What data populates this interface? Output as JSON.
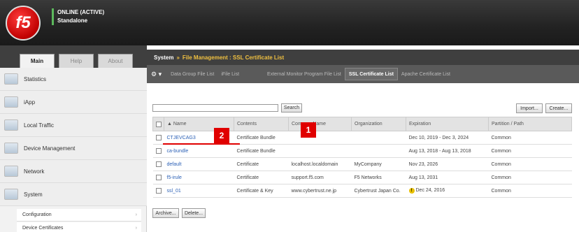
{
  "header": {
    "logo_text": "f5",
    "status_line1": "ONLINE (ACTIVE)",
    "status_line2": "Standalone"
  },
  "nav": {
    "tabs": [
      "Main",
      "Help",
      "About"
    ],
    "items": [
      "Statistics",
      "iApp",
      "Local Traffic",
      "Device Management",
      "Network",
      "System"
    ],
    "subitems": [
      "Configuration",
      "Device Certificates"
    ]
  },
  "breadcrumb": {
    "root": "System",
    "separator": "»",
    "path": "File Management : SSL Certificate List"
  },
  "tabs": [
    "Data Group File List",
    "iFile List",
    "External Monitor Program File List",
    "SSL Certificate List",
    "Apache Certificate List"
  ],
  "toolbar": {
    "search_label": "Search",
    "import_label": "Import...",
    "create_label": "Create..."
  },
  "table": {
    "columns": [
      "▲ Name",
      "Contents",
      "Common Name",
      "Organization",
      "Expiration",
      "Partition / Path"
    ],
    "rows": [
      {
        "name": "CTJEVCAG3",
        "contents": "Certificate Bundle",
        "common_name": "",
        "organization": "",
        "expiration": "Dec 10, 2019 - Dec 3, 2024",
        "partition": "Common"
      },
      {
        "name": "ca-bundle",
        "contents": "Certificate Bundle",
        "common_name": "",
        "organization": "",
        "expiration": "Aug 13, 2018 - Aug 13, 2018",
        "partition": "Common"
      },
      {
        "name": "default",
        "contents": "Certificate",
        "common_name": "localhost.localdomain",
        "organization": "MyCompany",
        "expiration": "Nov 23, 2026",
        "partition": "Common"
      },
      {
        "name": "f5-irule",
        "contents": "Certificate",
        "common_name": "support.f5.com",
        "organization": "F5 Networks",
        "expiration": "Aug 13, 2031",
        "partition": "Common"
      },
      {
        "name": "ssl_01",
        "contents": "Certificate & Key",
        "common_name": "www.cybertrust.ne.jp",
        "organization": "Cybertrust Japan Co.",
        "expiration": "Dec 24, 2016",
        "partition": "Common"
      }
    ]
  },
  "footer": {
    "archive_label": "Archive...",
    "delete_label": "Delete..."
  },
  "callouts": [
    "2",
    "1"
  ],
  "colors": {
    "header_bg": "#222222",
    "accent_red": "#e00000",
    "link_blue": "#2a5fb5",
    "breadcrumb_highlight": "#f0c040"
  }
}
